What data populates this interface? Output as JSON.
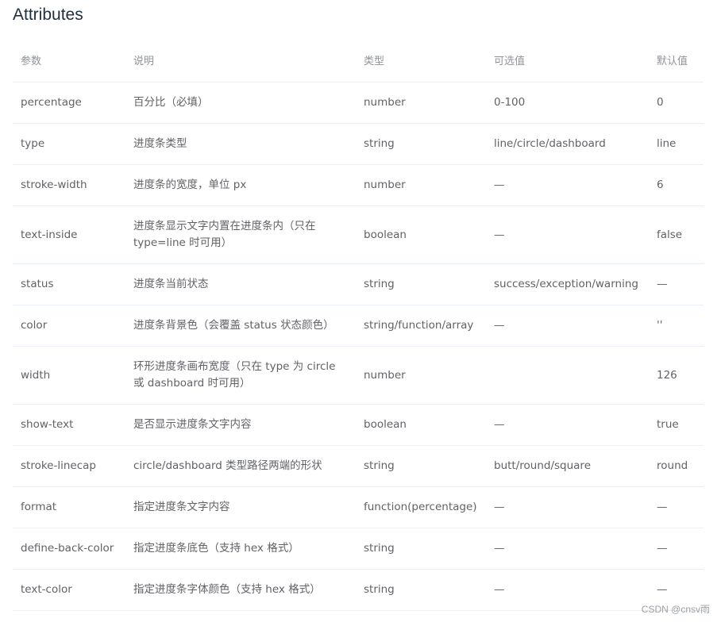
{
  "title": "Attributes",
  "table": {
    "headers": [
      "参数",
      "说明",
      "类型",
      "可选值",
      "默认值"
    ],
    "rows": [
      {
        "param": "percentage",
        "desc": "百分比（必填）",
        "type": "number",
        "options": "0-100",
        "default": "0"
      },
      {
        "param": "type",
        "desc": "进度条类型",
        "type": "string",
        "options": "line/circle/dashboard",
        "default": "line"
      },
      {
        "param": "stroke-width",
        "desc": "进度条的宽度，单位 px",
        "type": "number",
        "options": "—",
        "default": "6"
      },
      {
        "param": "text-inside",
        "desc": "进度条显示文字内置在进度条内（只在 type=line 时可用）",
        "type": "boolean",
        "options": "—",
        "default": "false"
      },
      {
        "param": "status",
        "desc": "进度条当前状态",
        "type": "string",
        "options": "success/exception/warning",
        "default": "—"
      },
      {
        "param": "color",
        "desc": "进度条背景色（会覆盖 status 状态颜色）",
        "type": "string/function/array",
        "options": "—",
        "default": "''"
      },
      {
        "param": "width",
        "desc": "环形进度条画布宽度（只在 type 为 circle 或 dashboard 时可用）",
        "type": "number",
        "options": "",
        "default": "126"
      },
      {
        "param": "show-text",
        "desc": "是否显示进度条文字内容",
        "type": "boolean",
        "options": "—",
        "default": "true"
      },
      {
        "param": "stroke-linecap",
        "desc": "circle/dashboard 类型路径两端的形状",
        "type": "string",
        "options": "butt/round/square",
        "default": "round"
      },
      {
        "param": "format",
        "desc": "指定进度条文字内容",
        "type": "function(percentage)",
        "options": "—",
        "default": "—"
      },
      {
        "param": "define-back-color",
        "desc": "指定进度条底色（支持 hex 格式）",
        "type": "string",
        "options": "—",
        "default": "—"
      },
      {
        "param": "text-color",
        "desc": "指定进度条字体颜色（支持 hex 格式）",
        "type": "string",
        "options": "—",
        "default": "—"
      }
    ]
  },
  "watermark": "CSDN @cnsv雨"
}
